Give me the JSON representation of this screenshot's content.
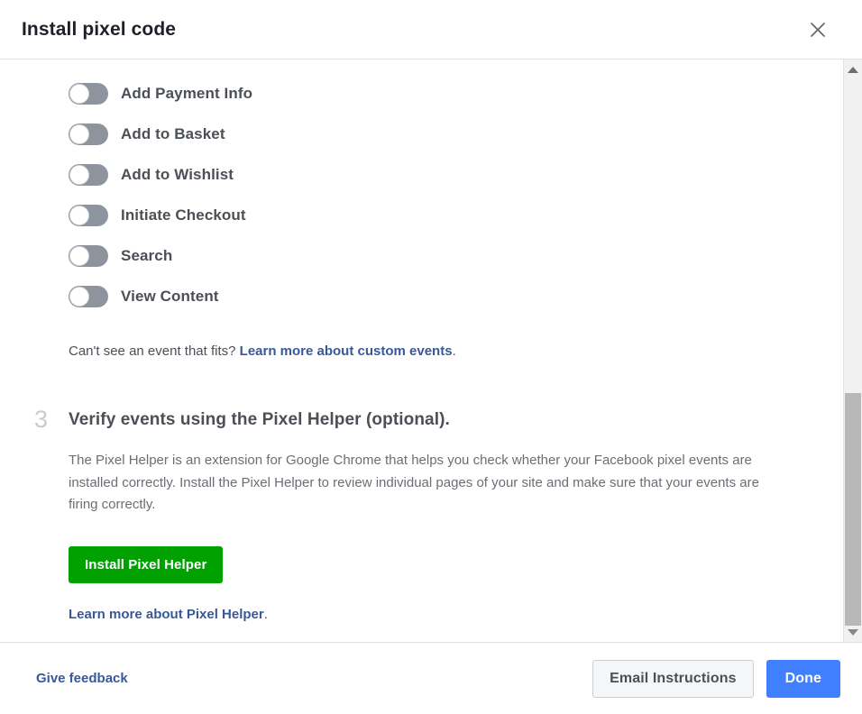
{
  "dialog": {
    "title": "Install pixel code",
    "close_icon": "close-icon"
  },
  "events": {
    "items": [
      {
        "label": "Add Payment Info",
        "enabled": false
      },
      {
        "label": "Add to Basket",
        "enabled": false
      },
      {
        "label": "Add to Wishlist",
        "enabled": false
      },
      {
        "label": "Initiate Checkout",
        "enabled": false
      },
      {
        "label": "Search",
        "enabled": false
      },
      {
        "label": "View Content",
        "enabled": false
      }
    ],
    "note_prefix": "Can't see an event that fits? ",
    "note_link": "Learn more about custom events",
    "note_suffix": "."
  },
  "step3": {
    "number": "3",
    "heading": "Verify events using the Pixel Helper (optional).",
    "paragraph": "The Pixel Helper is an extension for Google Chrome that helps you check whether your Facebook pixel events are installed correctly. Install the Pixel Helper to review individual pages of your site and make sure that your events are firing correctly.",
    "install_button": "Install Pixel Helper",
    "learn_more_link": "Learn more about Pixel Helper",
    "learn_more_suffix": "."
  },
  "footer": {
    "feedback_label": "Give feedback",
    "email_button": "Email Instructions",
    "done_button": "Done"
  },
  "scrollbar": {
    "up_icon": "chevron-up-icon",
    "down_icon": "chevron-down-icon"
  },
  "colors": {
    "link": "#385898",
    "install_green": "#02a102",
    "primary_blue": "#4080ff",
    "toggle_off_track": "#8d949e",
    "step_number": "#c7ccd1"
  }
}
